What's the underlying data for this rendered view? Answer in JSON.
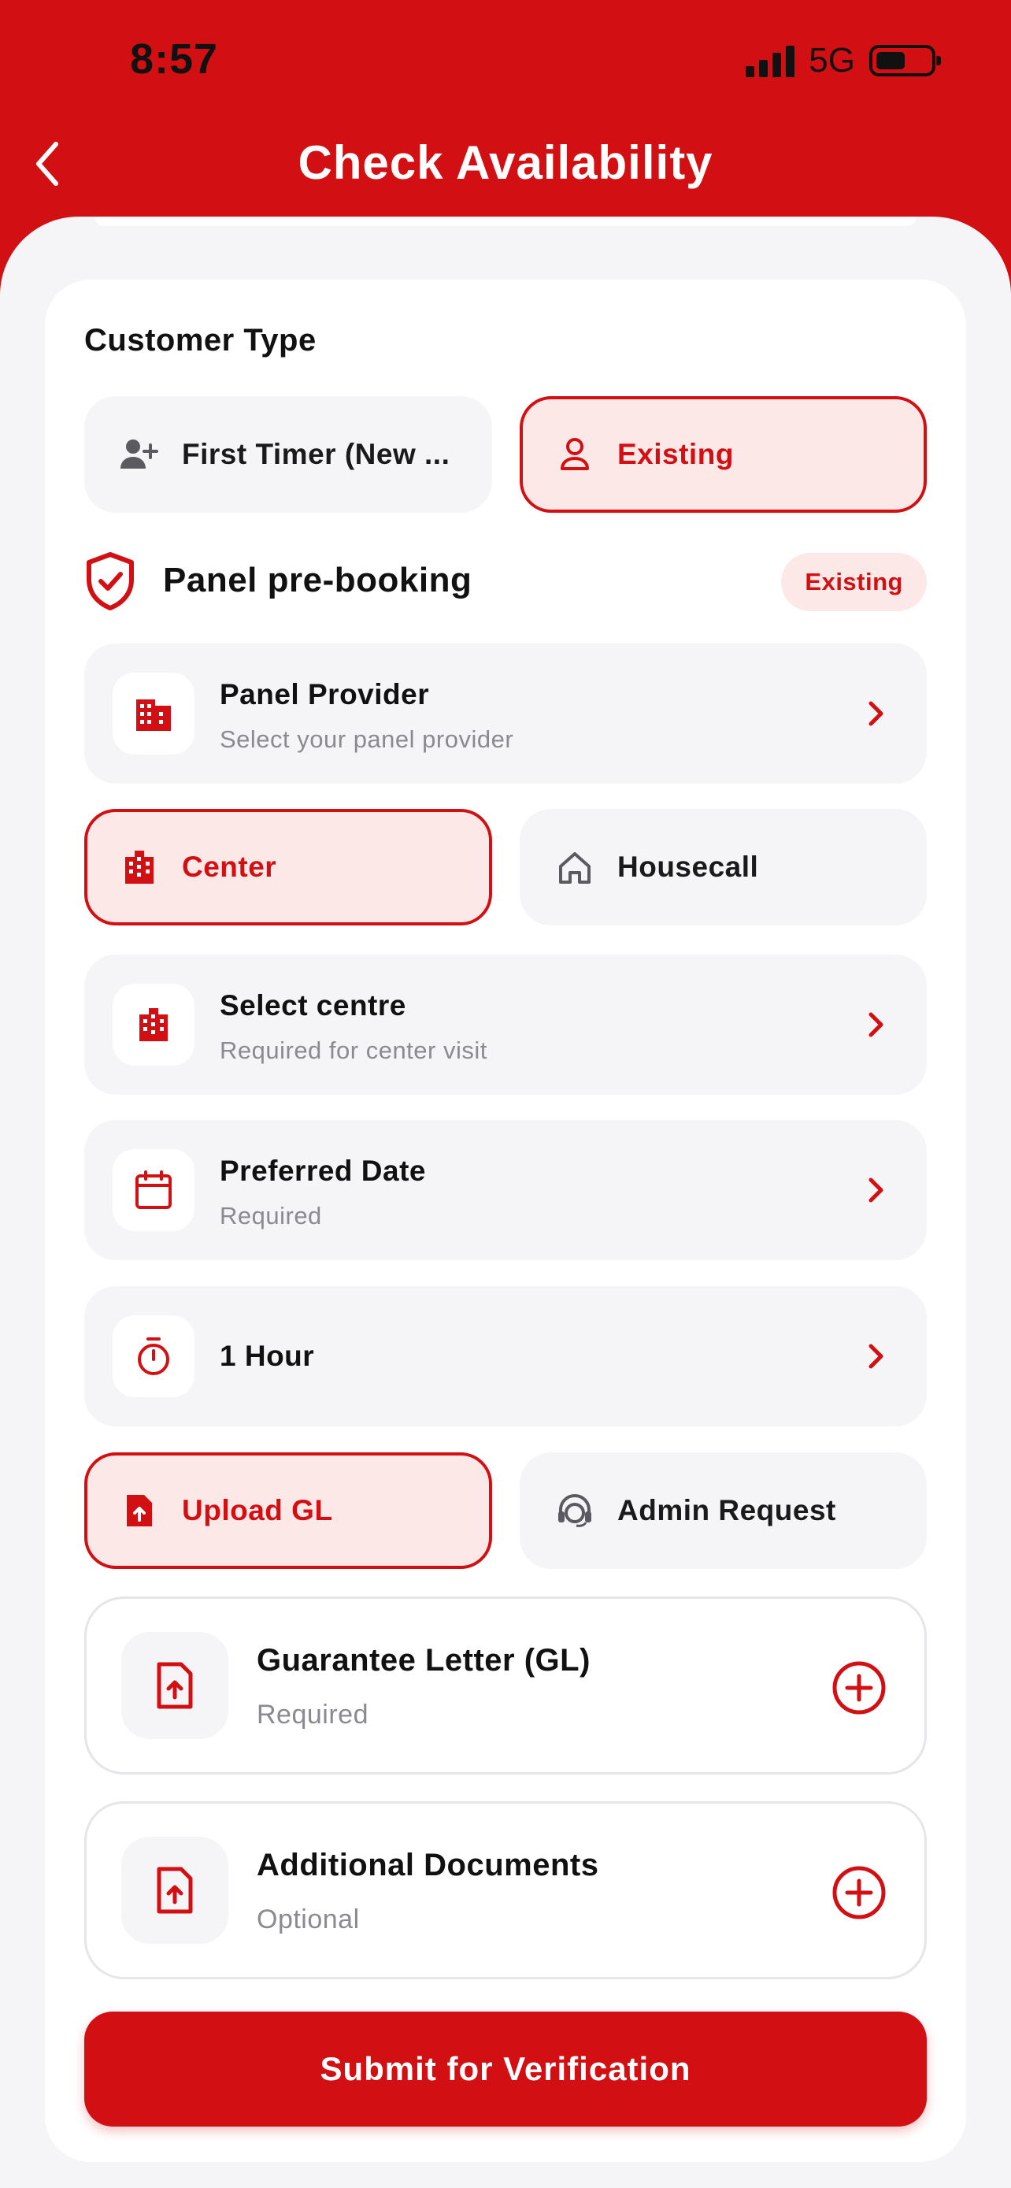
{
  "status_bar": {
    "time": "8:57",
    "network": "5G"
  },
  "header": {
    "title": "Check Availability"
  },
  "customer_type": {
    "label": "Customer Type",
    "options": [
      {
        "label": "First Timer (New ...",
        "selected": false
      },
      {
        "label": "Existing",
        "selected": true
      }
    ]
  },
  "panel": {
    "title": "Panel pre-booking",
    "badge": "Existing",
    "provider": {
      "title": "Panel Provider",
      "subtitle": "Select your panel provider"
    }
  },
  "visit_type": {
    "options": [
      {
        "label": "Center",
        "selected": true
      },
      {
        "label": "Housecall",
        "selected": false
      }
    ]
  },
  "centre": {
    "title": "Select centre",
    "subtitle": "Required for center visit"
  },
  "date": {
    "title": "Preferred Date",
    "subtitle": "Required"
  },
  "duration": {
    "title": "1 Hour"
  },
  "gl_mode": {
    "options": [
      {
        "label": "Upload GL",
        "selected": true
      },
      {
        "label": "Admin Request",
        "selected": false
      }
    ]
  },
  "documents": [
    {
      "title": "Guarantee Letter (GL)",
      "subtitle": "Required"
    },
    {
      "title": "Additional Documents",
      "subtitle": "Optional"
    }
  ],
  "submit_label": "Submit for Verification",
  "colors": {
    "primary": "#d20f12",
    "primary_light": "#fde8e8",
    "surface": "#f5f5f7",
    "muted_text": "#8a8a90"
  }
}
